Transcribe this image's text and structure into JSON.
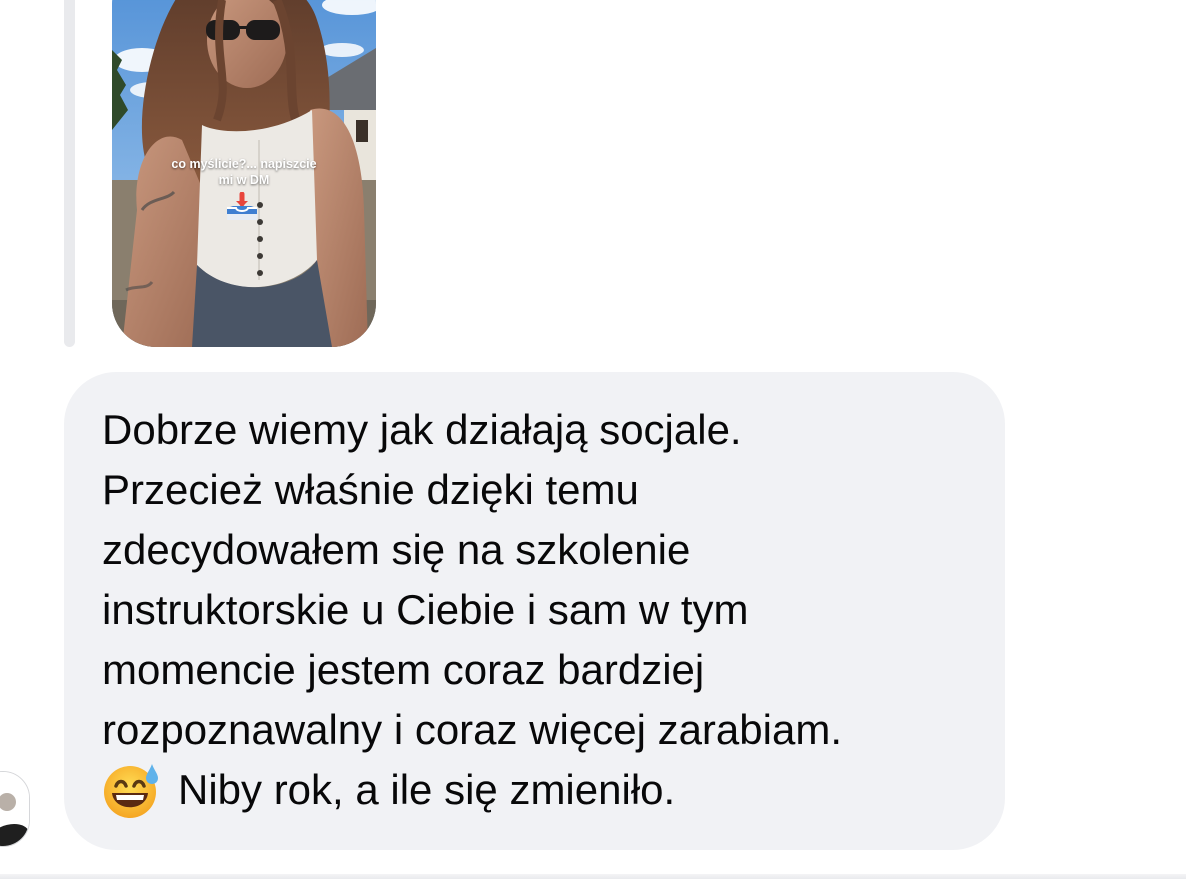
{
  "story": {
    "caption_line1": "co myślicie?... napiszcie",
    "caption_line2": "mi w DM",
    "icon": "inbox-tray-icon"
  },
  "message": {
    "lines": [
      "Dobrze wiemy jak działają socjale.",
      "Przecież właśnie dzięki temu",
      "zdecydowałem się na szkolenie",
      "instruktorskie u Ciebie i sam w tym",
      "momencie jestem coraz bardziej",
      "rozpoznawalny i coraz więcej zarabiam."
    ],
    "last_line_emoji": "grinning-sweat-emoji",
    "last_line_text": "Niby rok, a ile się zmieniło."
  },
  "colors": {
    "bubble": "#f1f2f5",
    "text": "#080809",
    "reply_line": "#e9eaed"
  }
}
